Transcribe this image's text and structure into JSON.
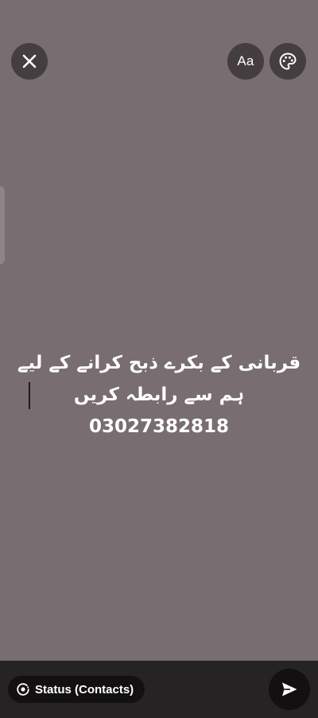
{
  "toolbar": {
    "close_icon": "close-icon",
    "font_label": "Aa",
    "palette_icon": "palette-icon"
  },
  "status": {
    "text": "قربانی کے بکرے ذبح کرانے کے لیے ہم سے رابطہ کریں 03027382818",
    "background_color": "#786d70",
    "text_color": "#ffffff"
  },
  "footer": {
    "audience_icon": "status-icon",
    "audience_label": "Status (Contacts)",
    "send_icon": "send-icon"
  }
}
